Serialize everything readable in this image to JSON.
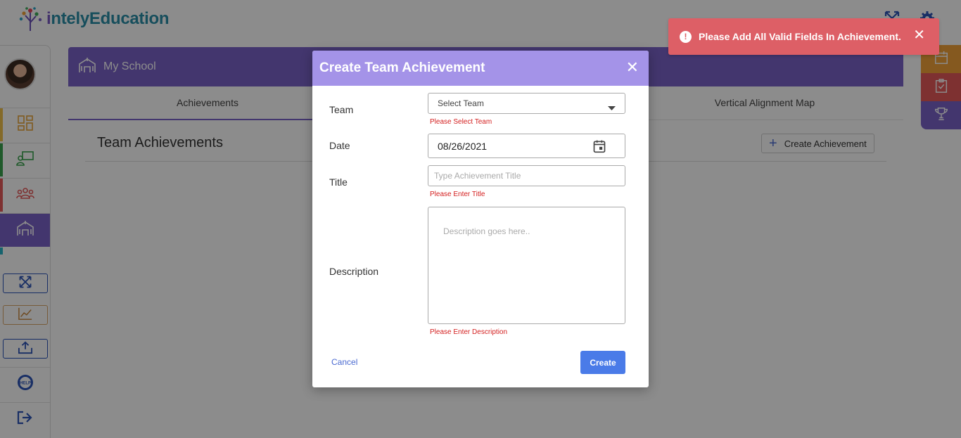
{
  "app": {
    "logo_prefix": "i",
    "logo_text": "ntelyEducation"
  },
  "toast": {
    "message": "Please Add All Valid Fields In Achievement.",
    "close": "✕"
  },
  "page": {
    "header_title": "My School",
    "tabs": [
      {
        "label": "Achievements"
      },
      {
        "label": "Vertical Alignment Map"
      }
    ],
    "section_title": "Team Achievements",
    "create_button": "Create Achievement"
  },
  "modal": {
    "title": "Create Team Achievement",
    "close": "✕",
    "team_label": "Team",
    "team_value": "Select Team",
    "team_error": "Please Select Team",
    "date_label": "Date",
    "date_value": "08/26/2021",
    "title_label": "Title",
    "title_placeholder": "Type Achievement Title",
    "title_error": "Please Enter Title",
    "description_label": "Description",
    "description_placeholder": "Description goes here..",
    "description_error": "Please Enter Description",
    "cancel": "Cancel",
    "create": "Create"
  },
  "colors": {
    "accent": "#7b63c8",
    "modal_header": "#a493e8",
    "toast": "#dd5f66",
    "error": "#d42020",
    "primary_button": "#4a7be8"
  }
}
